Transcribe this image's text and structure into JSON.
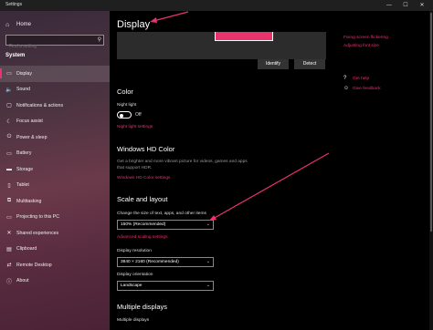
{
  "window": {
    "title": "Settings",
    "controls": {
      "minimize": "—",
      "maximize": "☐",
      "close": "✕"
    }
  },
  "sidebar": {
    "home_label": "Home",
    "search_placeholder": "Find a setting",
    "section_label": "System",
    "items": [
      {
        "label": "Display",
        "icon": "monitor-icon",
        "glyph": "▭",
        "active": true
      },
      {
        "label": "Sound",
        "icon": "speaker-icon",
        "glyph": "🔈"
      },
      {
        "label": "Notifications & actions",
        "icon": "notification-icon",
        "glyph": "▢"
      },
      {
        "label": "Focus assist",
        "icon": "moon-icon",
        "glyph": "☾"
      },
      {
        "label": "Power & sleep",
        "icon": "power-icon",
        "glyph": "⏻"
      },
      {
        "label": "Battery",
        "icon": "battery-icon",
        "glyph": "▭"
      },
      {
        "label": "Storage",
        "icon": "storage-icon",
        "glyph": "▬"
      },
      {
        "label": "Tablet",
        "icon": "tablet-icon",
        "glyph": "▯"
      },
      {
        "label": "Multitasking",
        "icon": "multitasking-icon",
        "glyph": "⧉"
      },
      {
        "label": "Projecting to this PC",
        "icon": "projector-icon",
        "glyph": "▭"
      },
      {
        "label": "Shared experiences",
        "icon": "shared-icon",
        "glyph": "✕"
      },
      {
        "label": "Clipboard",
        "icon": "clipboard-icon",
        "glyph": "▤"
      },
      {
        "label": "Remote Desktop",
        "icon": "remote-desktop-icon",
        "glyph": "⇄"
      },
      {
        "label": "About",
        "icon": "info-icon",
        "glyph": "ⓘ"
      }
    ]
  },
  "main": {
    "title": "Display",
    "identify_label": "Identify",
    "detect_label": "Detect",
    "related_links": [
      "Fixing screen flickering",
      "Adjusting font size"
    ],
    "help": [
      {
        "label": "Get help",
        "icon": "help-icon",
        "glyph": "?"
      },
      {
        "label": "Give feedback",
        "icon": "feedback-icon",
        "glyph": "☺"
      }
    ],
    "color": {
      "heading": "Color",
      "night_light_label": "Night light",
      "night_light_state": "Off",
      "night_light_settings": "Night light settings"
    },
    "hd_color": {
      "heading": "Windows HD Color",
      "description": "Get a brighter and more vibrant picture for videos, games and apps that support HDR.",
      "link": "Windows HD Color settings"
    },
    "scale": {
      "heading": "Scale and layout",
      "size_label": "Change the size of text, apps, and other items",
      "size_value": "150% (Recommended)",
      "advanced_link": "Advanced scaling settings",
      "resolution_label": "Display resolution",
      "resolution_value": "3840 × 2160 (Recommended)",
      "orientation_label": "Display orientation",
      "orientation_value": "Landscape"
    },
    "multiple": {
      "heading": "Multiple displays",
      "label": "Multiple displays"
    }
  },
  "colors": {
    "accent": "#e8336d"
  }
}
